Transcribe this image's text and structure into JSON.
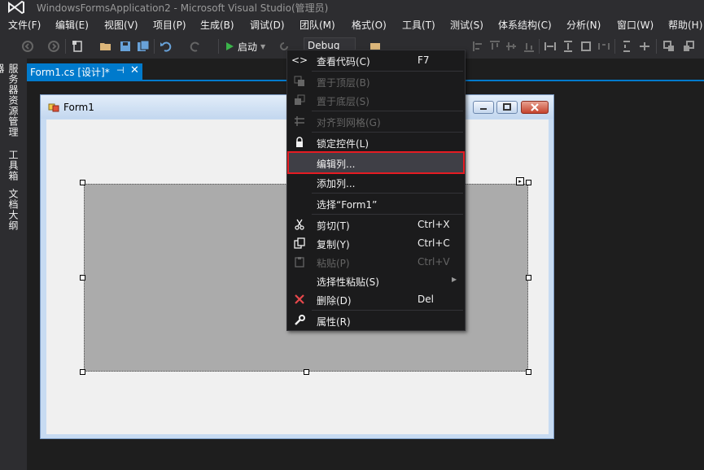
{
  "window": {
    "title": "WindowsFormsApplication2 - Microsoft Visual Studio(管理员)"
  },
  "menubar": {
    "items": [
      "文件(F)",
      "编辑(E)",
      "视图(V)",
      "项目(P)",
      "生成(B)",
      "调试(D)",
      "团队(M)",
      "格式(O)",
      "工具(T)",
      "测试(S)",
      "体系结构(C)",
      "分析(N)",
      "窗口(W)",
      "帮助(H)"
    ]
  },
  "toolbar": {
    "start_label": "启动",
    "configuration": "Debug"
  },
  "side_tabs": [
    "服务器资源管理器",
    "工具箱",
    "文档大纲"
  ],
  "document_tab": {
    "title": "Form1.cs [设计]*",
    "pin": "⊣",
    "close": "✕"
  },
  "form": {
    "title": "Form1"
  },
  "context_menu": {
    "items": [
      {
        "label": "查看代码(C)",
        "shortcut": "F7",
        "icon": "code-icon",
        "enabled": true
      },
      {
        "label": "置于顶层(B)",
        "shortcut": "",
        "icon": "bring-to-front-icon",
        "enabled": false
      },
      {
        "label": "置于底层(S)",
        "shortcut": "",
        "icon": "send-to-back-icon",
        "enabled": false
      },
      {
        "label": "对齐到网格(G)",
        "shortcut": "",
        "icon": "align-to-grid-icon",
        "enabled": false
      },
      {
        "label": "锁定控件(L)",
        "shortcut": "",
        "icon": "lock-icon",
        "enabled": true
      },
      {
        "label": "编辑列...",
        "shortcut": "",
        "icon": "",
        "enabled": true,
        "highlighted": true
      },
      {
        "label": "添加列...",
        "shortcut": "",
        "icon": "",
        "enabled": true
      },
      {
        "label": "选择“Form1”",
        "shortcut": "",
        "icon": "",
        "enabled": true
      },
      {
        "label": "剪切(T)",
        "shortcut": "Ctrl+X",
        "icon": "cut-icon",
        "enabled": true
      },
      {
        "label": "复制(Y)",
        "shortcut": "Ctrl+C",
        "icon": "copy-icon",
        "enabled": true
      },
      {
        "label": "粘贴(P)",
        "shortcut": "Ctrl+V",
        "icon": "paste-icon",
        "enabled": false
      },
      {
        "label": "选择性粘贴(S)",
        "shortcut": "",
        "icon": "",
        "enabled": true,
        "submenu": true
      },
      {
        "label": "删除(D)",
        "shortcut": "Del",
        "icon": "delete-icon",
        "enabled": true
      },
      {
        "label": "属性(R)",
        "shortcut": "",
        "icon": "wrench-icon",
        "enabled": true
      }
    ]
  },
  "colors": {
    "accent": "#007acc",
    "highlight_border": "#e51c23",
    "delete_icon": "#e8484c"
  }
}
